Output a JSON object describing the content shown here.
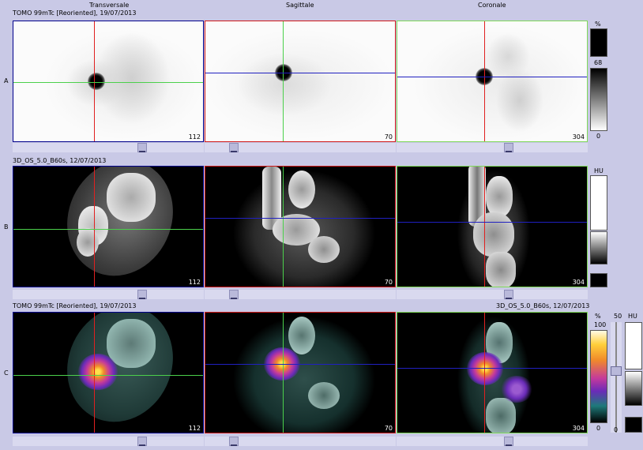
{
  "columns": {
    "transverse": "Transversale",
    "sagittal": "Sagittale",
    "coronal": "Coronale"
  },
  "rows": {
    "a": {
      "letter": "A",
      "header": "TOMO 99mTc [Reoriented], 19/07/2013"
    },
    "b": {
      "letter": "B",
      "header": "3D_OS_5.0_B60s, 12/07/2013"
    },
    "c": {
      "letter": "C",
      "header_left": "TOMO 99mTc [Reoriented], 19/07/2013",
      "header_right": "3D_OS_5.0_B60s, 12/07/2013"
    }
  },
  "slice_numbers": {
    "transverse": "112",
    "sagittal": "70",
    "coronal": "304"
  },
  "colorbars": {
    "a": {
      "unit": "%",
      "level": "68",
      "min": "0"
    },
    "b": {
      "unit": "HU"
    },
    "c": {
      "unit_pct": "%",
      "max": "100",
      "min": "0",
      "fusion": "50",
      "unit_hu": "HU",
      "fusion_min": "0"
    }
  },
  "colors": {
    "background": "#c9c9e6",
    "transverse_frame": "#00008b",
    "sagittal_frame": "#d01818",
    "coronal_frame": "#7ed957",
    "red_cross": "#e02020",
    "green_cross": "#4bd04b",
    "blue_cross": "#2020c0"
  }
}
